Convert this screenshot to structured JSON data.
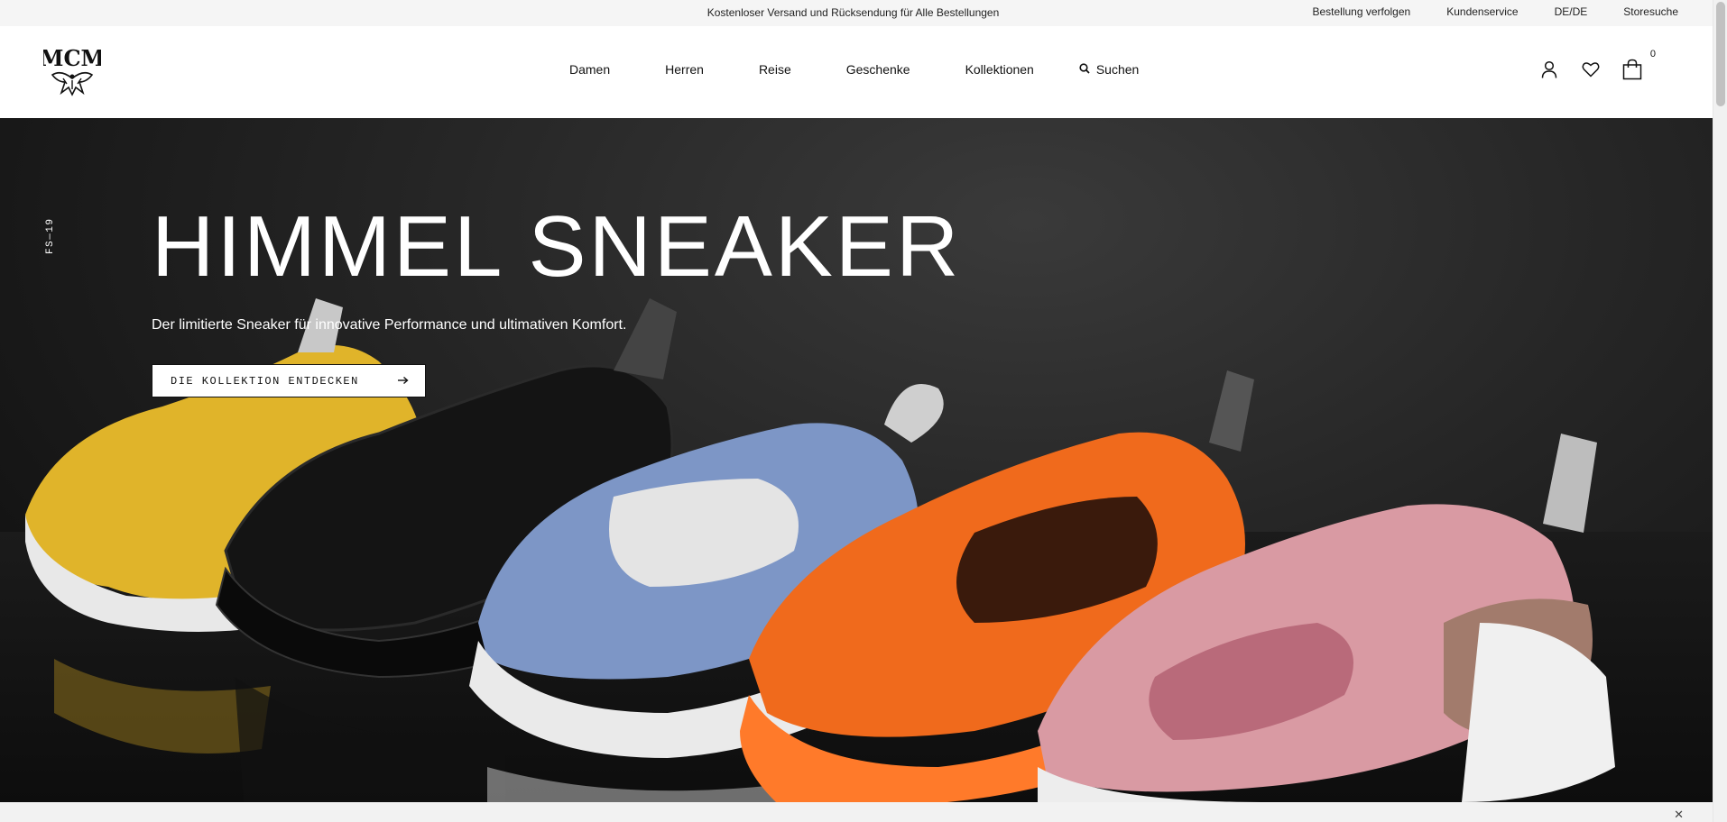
{
  "topbar": {
    "promo": "Kostenloser Versand und Rücksendung für Alle Bestellungen",
    "links": [
      "Bestellung verfolgen",
      "Kundenservice",
      "DE/DE",
      "Storesuche"
    ]
  },
  "header": {
    "logo_text": "MCM",
    "nav": [
      "Damen",
      "Herren",
      "Reise",
      "Geschenke",
      "Kollektionen"
    ],
    "search_label": "Suchen",
    "cart_count": "0",
    "icons": [
      "user-icon",
      "heart-icon",
      "shopping-bag-icon",
      "search-icon"
    ]
  },
  "hero": {
    "season": "FS—19",
    "title": "HIMMEL SNEAKER",
    "subtitle": "Der limitierte Sneaker für innovative Performance und ultimativen Komfort.",
    "cta_label": "DIE KOLLEKTION ENTDECKEN",
    "cta_icon": "arrow-right-icon",
    "image": "sneaker-lineup",
    "colors": {
      "background": "#1c1c1c",
      "sneaker_yellow": "#e0b42a",
      "sneaker_black": "#1a1a1a",
      "sneaker_blue": "#7d96c6",
      "sneaker_orange": "#f06a1c",
      "sneaker_pink": "#d99aa3"
    }
  },
  "banner": {
    "close_icon": "close-icon"
  }
}
